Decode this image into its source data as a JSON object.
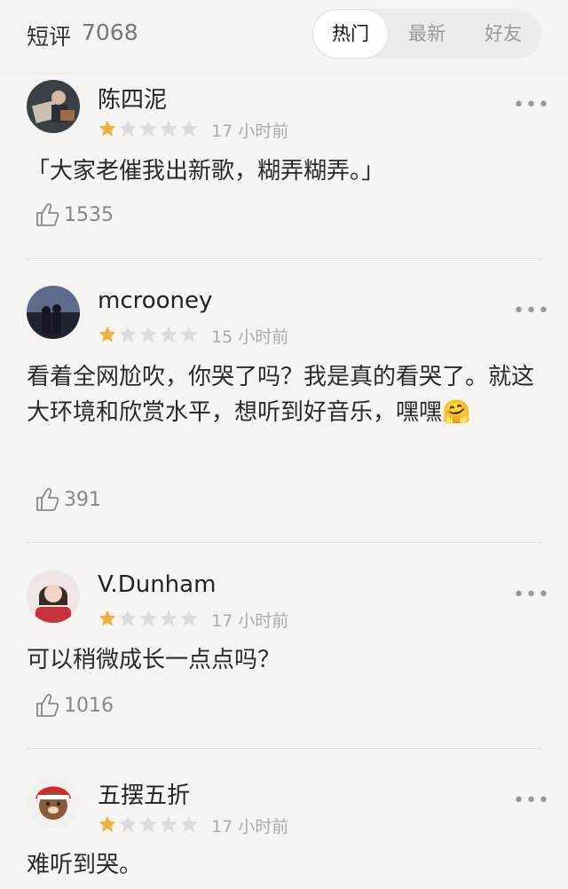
{
  "header": {
    "title": "短评",
    "count": "7068",
    "tabs": [
      {
        "label": "热门",
        "active": true
      },
      {
        "label": "最新",
        "active": false
      },
      {
        "label": "好友",
        "active": false
      }
    ]
  },
  "icons": {
    "more": "more-dots-icon",
    "like": "thumbs-up-icon",
    "star": "star-icon"
  },
  "colors": {
    "star_filled": "#f0b23c",
    "star_empty": "#dcdcdc"
  },
  "comments": [
    {
      "username": "陈四泥",
      "rating": 1,
      "max_rating": 5,
      "time": "17 小时前",
      "text": "「大家老催我出新歌，糊弄糊弄。」",
      "likes": "1535"
    },
    {
      "username": "mcrooney",
      "rating": 1,
      "max_rating": 5,
      "time": "15 小时前",
      "text": "看着全网尬吹，你哭了吗？我是真的看哭了。就这大环境和欣赏水平，想听到好音乐，嘿嘿🤗",
      "likes": "391"
    },
    {
      "username": "V.Dunham",
      "rating": 1,
      "max_rating": 5,
      "time": "17 小时前",
      "text": "可以稍微成长一点点吗？",
      "likes": "1016"
    },
    {
      "username": "五摆五折",
      "rating": 1,
      "max_rating": 5,
      "time": "17 小时前",
      "text": "难听到哭。",
      "likes": ""
    }
  ]
}
